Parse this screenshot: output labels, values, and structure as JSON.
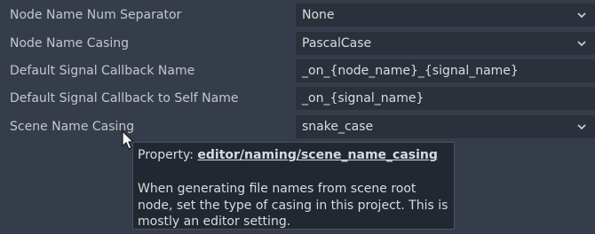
{
  "settings": [
    {
      "label": "Node Name Num Separator",
      "value": "None",
      "type": "dropdown"
    },
    {
      "label": "Node Name Casing",
      "value": "PascalCase",
      "type": "dropdown"
    },
    {
      "label": "Default Signal Callback Name",
      "value": "_on_{node_name}_{signal_name}",
      "type": "text"
    },
    {
      "label": "Default Signal Callback to Self Name",
      "value": "_on_{signal_name}",
      "type": "text"
    },
    {
      "label": "Scene Name Casing",
      "value": "snake_case",
      "type": "dropdown"
    }
  ],
  "tooltip": {
    "property_prefix": "Property:",
    "property_path": "editor/naming/scene_name_casing",
    "description": "When generating file names from scene root node, set the type of casing in this project. This is mostly an editor setting."
  },
  "icons": {
    "dropdown": "chevron-down-icon",
    "cursor": "mouse-cursor-icon"
  }
}
